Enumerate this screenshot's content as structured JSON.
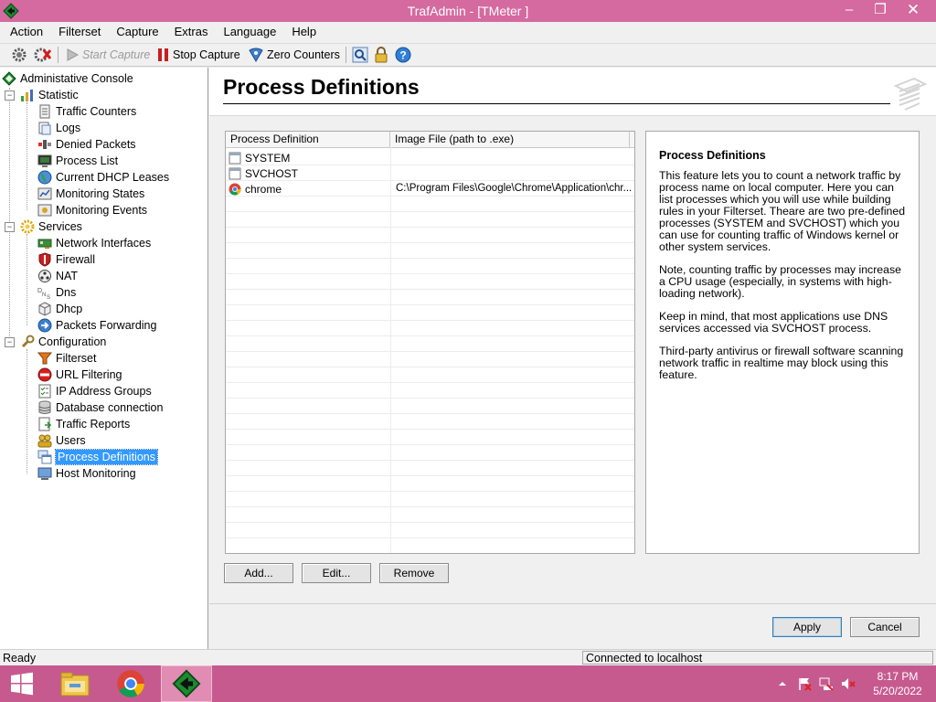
{
  "window": {
    "title": "TrafAdmin - [TMeter ]",
    "min": "–",
    "max": "❐",
    "close": "✕"
  },
  "menu": [
    "Action",
    "Filterset",
    "Capture",
    "Extras",
    "Language",
    "Help"
  ],
  "toolbar": {
    "start_capture": "Start Capture",
    "stop_capture": "Stop Capture",
    "zero_counters": "Zero Counters"
  },
  "tree": {
    "root": "Administative Console",
    "statistic": {
      "label": "Statistic",
      "items": [
        "Traffic Counters",
        "Logs",
        "Denied Packets",
        "Process List",
        "Current DHCP Leases",
        "Monitoring States",
        "Monitoring Events"
      ]
    },
    "services": {
      "label": "Services",
      "items": [
        "Network Interfaces",
        "Firewall",
        "NAT",
        "Dns",
        "Dhcp",
        "Packets Forwarding"
      ]
    },
    "configuration": {
      "label": "Configuration",
      "items": [
        "Filterset",
        "URL Filtering",
        "IP Address Groups",
        "Database connection",
        "Traffic Reports",
        "Users",
        "Process Definitions",
        "Host Monitoring"
      ]
    },
    "expander_symbol": "−"
  },
  "page": {
    "title": "Process Definitions"
  },
  "list": {
    "columns": [
      "Process Definition",
      "Image File (path to .exe)"
    ],
    "rows": [
      {
        "name": "SYSTEM",
        "path": ""
      },
      {
        "name": "SVCHOST",
        "path": ""
      },
      {
        "name": "chrome",
        "path": "C:\\Program Files\\Google\\Chrome\\Application\\chr..."
      }
    ]
  },
  "info": {
    "title": "Process Definitions",
    "paragraphs": [
      "This feature lets you to count a network traffic by process name on local computer. Here you can list processes which you will use while building rules in your Filterset. Theare are two pre-defined processes (SYSTEM and SVCHOST) which you can use for counting traffic of Windows kernel or other system services.",
      "Note, counting traffic by processes may increase a CPU usage (especially, in systems with high-loading network).",
      "Keep in mind, that most applications use DNS services accessed via SVCHOST process.",
      "Third-party antivirus or firewall software scanning network traffic in realtime may block using this feature."
    ]
  },
  "buttons": {
    "add": "Add...",
    "edit": "Edit...",
    "remove": "Remove",
    "apply": "Apply",
    "cancel": "Cancel"
  },
  "status": {
    "left": "Ready",
    "right": "Connected to localhost"
  },
  "taskbar": {
    "time": "8:17 PM",
    "date": "5/20/2022"
  },
  "colors": {
    "titlebar": "#d46aa0",
    "taskbar": "#c65a8f",
    "selection": "#3399ff"
  }
}
